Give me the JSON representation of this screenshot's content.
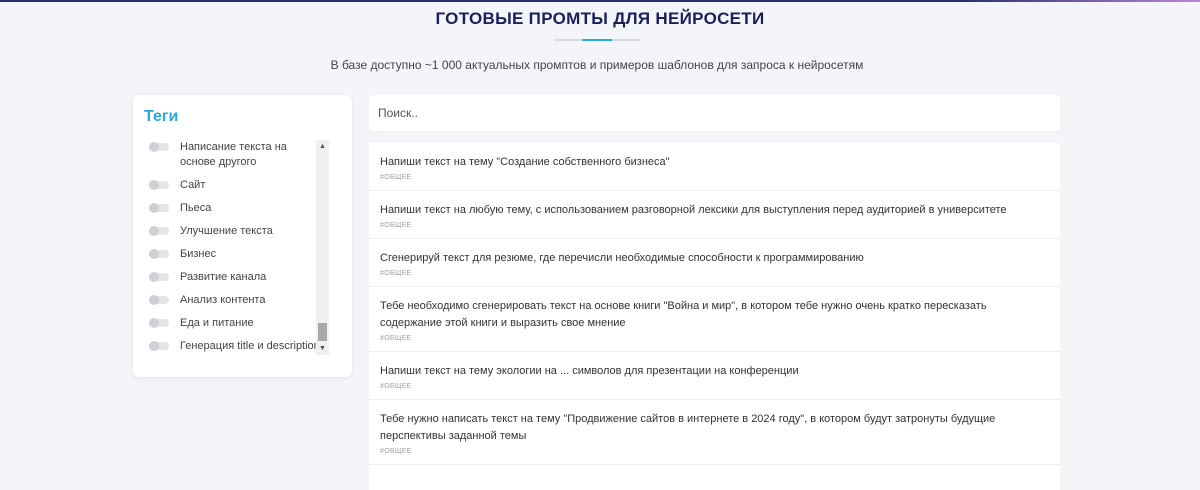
{
  "header": {
    "title": "ГОТОВЫЕ ПРОМТЫ ДЛЯ НЕЙРОСЕТИ",
    "subtitle": "В базе доступно ~1 000 актуальных промптов и примеров шаблонов для запроса к нейросетям"
  },
  "tags": {
    "title": "Теги",
    "items": [
      "Написание текста на основе другого",
      "Сайт",
      "Пьеса",
      "Улучшение текста",
      "Бизнес",
      "Развитие канала",
      "Анализ контента",
      "Еда и питание",
      "Генерация title и description"
    ]
  },
  "search": {
    "placeholder": "Поиск.."
  },
  "prompts": [
    {
      "text": "Напиши текст на тему \"Создание собственного бизнеса\"",
      "tag": "#ОБЩЕЕ"
    },
    {
      "text": "Напиши текст на любую тему, с использованием разговорной лексики для выступления перед аудиторией в университете",
      "tag": "#ОБЩЕЕ"
    },
    {
      "text": "Сгенерируй текст для резюме, где перечисли необходимые способности к программированию",
      "tag": "#ОБЩЕЕ"
    },
    {
      "text": "Тебе необходимо сгенерировать текст на основе книги \"Война и мир\", в котором тебе нужно очень кратко пересказать содержание этой книги и выразить свое мнение",
      "tag": "#ОБЩЕЕ"
    },
    {
      "text": "Напиши текст на тему экологии на ... символов для презентации на конференции",
      "tag": "#ОБЩЕЕ"
    },
    {
      "text": "Тебе нужно написать текст на тему \"Продвижение сайтов в интернете в 2024 году\", в котором будут затронуты будущие перспективы заданной темы",
      "tag": "#ОБЩЕЕ"
    }
  ]
}
